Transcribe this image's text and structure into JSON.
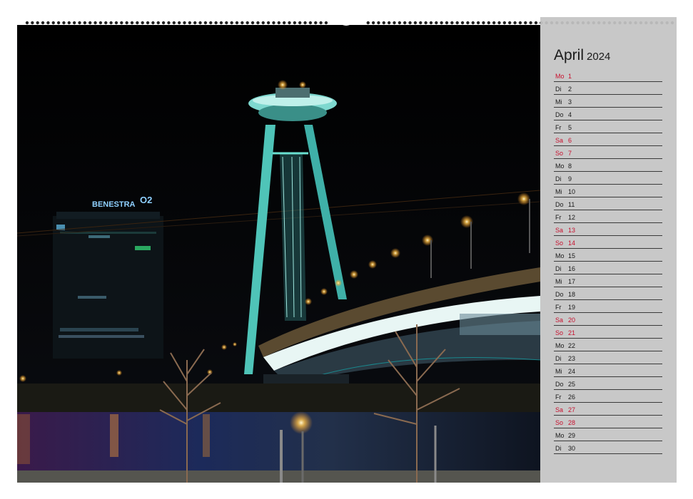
{
  "calendar": {
    "month": "April",
    "year": "2024",
    "weekend_color": "#c8102e",
    "days": [
      {
        "wd": "Mo",
        "d": "1",
        "weekend": true
      },
      {
        "wd": "Di",
        "d": "2",
        "weekend": false
      },
      {
        "wd": "Mi",
        "d": "3",
        "weekend": false
      },
      {
        "wd": "Do",
        "d": "4",
        "weekend": false
      },
      {
        "wd": "Fr",
        "d": "5",
        "weekend": false
      },
      {
        "wd": "Sa",
        "d": "6",
        "weekend": true
      },
      {
        "wd": "So",
        "d": "7",
        "weekend": true
      },
      {
        "wd": "Mo",
        "d": "8",
        "weekend": false
      },
      {
        "wd": "Di",
        "d": "9",
        "weekend": false
      },
      {
        "wd": "Mi",
        "d": "10",
        "weekend": false
      },
      {
        "wd": "Do",
        "d": "11",
        "weekend": false
      },
      {
        "wd": "Fr",
        "d": "12",
        "weekend": false
      },
      {
        "wd": "Sa",
        "d": "13",
        "weekend": true
      },
      {
        "wd": "So",
        "d": "14",
        "weekend": true
      },
      {
        "wd": "Mo",
        "d": "15",
        "weekend": false
      },
      {
        "wd": "Di",
        "d": "16",
        "weekend": false
      },
      {
        "wd": "Mi",
        "d": "17",
        "weekend": false
      },
      {
        "wd": "Do",
        "d": "18",
        "weekend": false
      },
      {
        "wd": "Fr",
        "d": "19",
        "weekend": false
      },
      {
        "wd": "Sa",
        "d": "20",
        "weekend": true
      },
      {
        "wd": "So",
        "d": "21",
        "weekend": true
      },
      {
        "wd": "Mo",
        "d": "22",
        "weekend": false
      },
      {
        "wd": "Di",
        "d": "23",
        "weekend": false
      },
      {
        "wd": "Mi",
        "d": "24",
        "weekend": false
      },
      {
        "wd": "Do",
        "d": "25",
        "weekend": false
      },
      {
        "wd": "Fr",
        "d": "26",
        "weekend": false
      },
      {
        "wd": "Sa",
        "d": "27",
        "weekend": true
      },
      {
        "wd": "So",
        "d": "28",
        "weekend": true
      },
      {
        "wd": "Mo",
        "d": "29",
        "weekend": false
      },
      {
        "wd": "Di",
        "d": "30",
        "weekend": false
      }
    ]
  },
  "photo": {
    "building_sign": "BENESTRA",
    "logo_mark": "O2",
    "tower_color": "#5ed8c8",
    "sky_color": "#050608"
  }
}
